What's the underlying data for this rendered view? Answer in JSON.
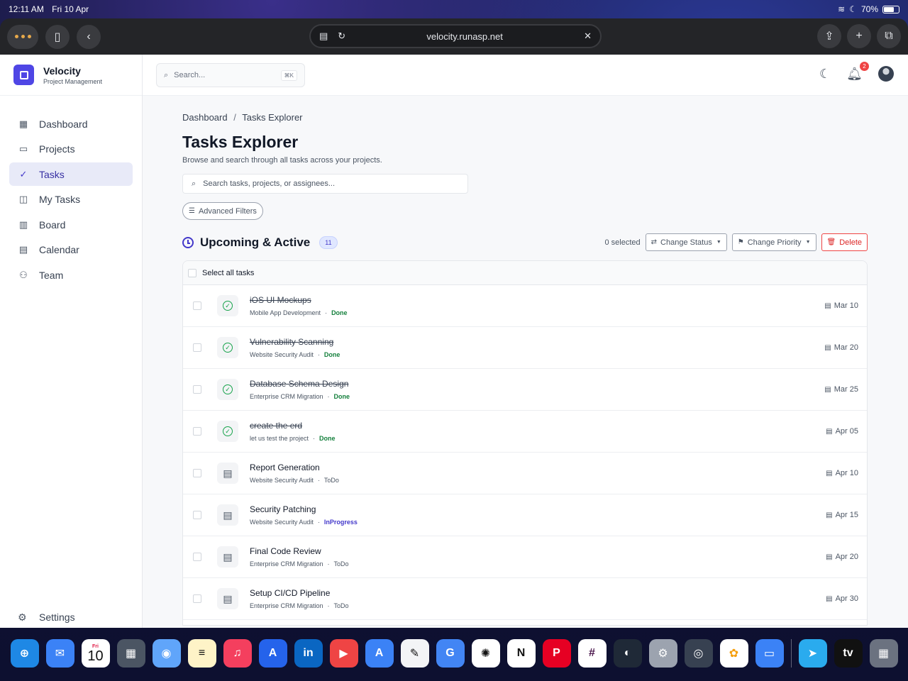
{
  "status_bar": {
    "time": "12:11 AM",
    "date": "Fri 10 Apr",
    "battery": "70%"
  },
  "browser": {
    "url": "velocity.runasp.net"
  },
  "brand": {
    "name": "Velocity",
    "subtitle": "Project Management"
  },
  "global_search": {
    "placeholder": "Search...",
    "shortcut": "⌘K"
  },
  "notifications": {
    "count": "2"
  },
  "sidebar": {
    "items": [
      {
        "label": "Dashboard",
        "icon": "dashboard-icon"
      },
      {
        "label": "Projects",
        "icon": "folder-icon"
      },
      {
        "label": "Tasks",
        "icon": "check-circle-icon",
        "active": true
      },
      {
        "label": "My Tasks",
        "icon": "user-square-icon"
      },
      {
        "label": "Board",
        "icon": "board-icon"
      },
      {
        "label": "Calendar",
        "icon": "calendar-icon"
      },
      {
        "label": "Team",
        "icon": "users-icon"
      }
    ],
    "settings_label": "Settings"
  },
  "breadcrumb": {
    "root": "Dashboard",
    "separator": "/",
    "current": "Tasks Explorer"
  },
  "page": {
    "title": "Tasks Explorer",
    "subtitle": "Browse and search through all tasks across your projects.",
    "search_placeholder": "Search tasks, projects, or assignees...",
    "advanced_filters_label": "Advanced Filters"
  },
  "section": {
    "title": "Upcoming & Active",
    "count": "11",
    "selected_text": "0 selected",
    "change_status_label": "Change Status",
    "change_priority_label": "Change Priority",
    "delete_label": "Delete",
    "select_all_label": "Select all tasks"
  },
  "tasks": [
    {
      "name": "iOS UI Mockups",
      "project": "Mobile App Development",
      "status": "Done",
      "due": "Mar 10"
    },
    {
      "name": "Vulnerability Scanning",
      "project": "Website Security Audit",
      "status": "Done",
      "due": "Mar 20"
    },
    {
      "name": "Database Schema Design",
      "project": "Enterprise CRM Migration",
      "status": "Done",
      "due": "Mar 25"
    },
    {
      "name": "create the erd",
      "project": "let us test the project",
      "status": "Done",
      "due": "Apr 05"
    },
    {
      "name": "Report Generation",
      "project": "Website Security Audit",
      "status": "ToDo",
      "due": "Apr 10"
    },
    {
      "name": "Security Patching",
      "project": "Website Security Audit",
      "status": "InProgress",
      "due": "Apr 15"
    },
    {
      "name": "Final Code Review",
      "project": "Enterprise CRM Migration",
      "status": "ToDo",
      "due": "Apr 20"
    },
    {
      "name": "Setup CI/CD Pipeline",
      "project": "Enterprise CRM Migration",
      "status": "ToDo",
      "due": "Apr 30"
    }
  ],
  "dock": {
    "apps": [
      "Safari",
      "Mail",
      "Calendar",
      "Calculator",
      "Files",
      "Notes",
      "Music",
      "App Store",
      "LinkedIn",
      "YouTube",
      "Translate",
      "Freeform",
      "Google Translate",
      "ChatGPT",
      "Notion",
      "Pinterest",
      "Slack",
      "Figma",
      "Settings",
      "Camera",
      "Photos",
      "Files Folder",
      "Telegram",
      "Apple TV",
      "App Library"
    ],
    "calendar_day": "Fri",
    "calendar_date": "10",
    "appletv_label": "tv"
  },
  "colors": {
    "accent": "#4f46e5",
    "done": "#15803d",
    "inprogress": "#4338ca",
    "danger": "#dc2626"
  }
}
